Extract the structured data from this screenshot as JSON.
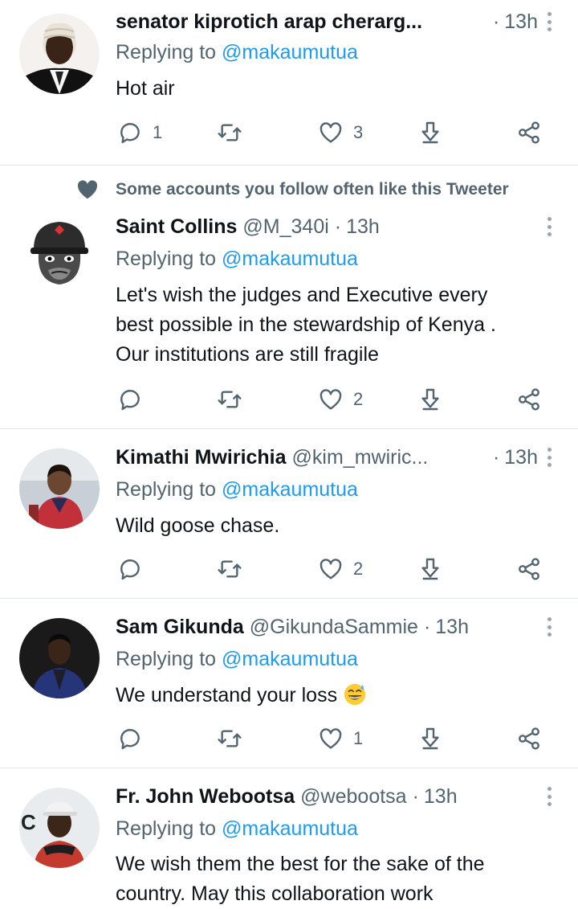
{
  "replying_prefix": "Replying to",
  "social_context": "Some accounts you follow often like this Tweeter",
  "colors": {
    "text": "#0f1419",
    "muted": "#536471",
    "link": "#1d9bf0",
    "divider": "#e1e6ea"
  },
  "tweets": [
    {
      "name": "senator kiprotich arap cherarg...",
      "handle": "",
      "time": "13h",
      "replying_to": "@makaumutua",
      "text": "Hot air",
      "replies": "1",
      "retweets": "",
      "likes": "3",
      "avatar_icon": "judge-wig-avatar"
    },
    {
      "name": "Saint Collins",
      "handle": "@M_340i",
      "time": "13h",
      "replying_to": "@makaumutua",
      "text_lines": [
        "Let's wish the judges and Executive every",
        "best possible in the stewardship of Kenya .",
        "Our institutions are still fragile"
      ],
      "replies": "",
      "retweets": "",
      "likes": "2",
      "avatar_icon": "gorilla-helmet-avatar"
    },
    {
      "name": "Kimathi Mwirichia",
      "handle": "@kim_mwiric...",
      "time": "13h",
      "replying_to": "@makaumutua",
      "text": "Wild goose chase.",
      "replies": "",
      "retweets": "",
      "likes": "2",
      "avatar_icon": "child-photo-avatar"
    },
    {
      "name": "Sam Gikunda",
      "handle": "@GikundaSammie",
      "time": "13h",
      "replying_to": "@makaumutua",
      "text": "We understand your loss",
      "emoji": "sweat-smile-emoji",
      "replies": "",
      "retweets": "",
      "likes": "1",
      "avatar_icon": "man-suit-avatar"
    },
    {
      "name": "Fr. John Webootsa",
      "handle": "@webootsa",
      "time": "13h",
      "replying_to": "@makaumutua",
      "text_lines": [
        "We wish them the best for the sake of the",
        "country.  May this collaboration work"
      ],
      "avatar_icon": "man-cap-avatar"
    }
  ]
}
